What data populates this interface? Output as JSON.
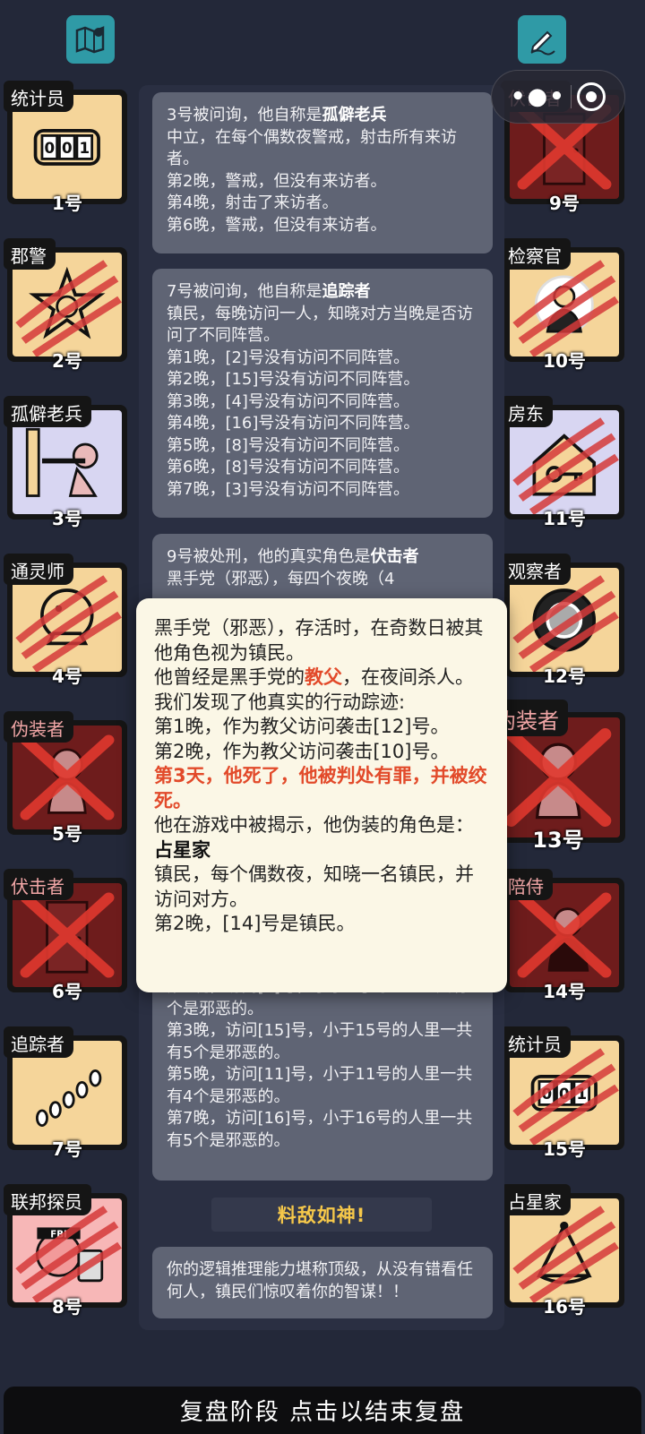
{
  "header": {
    "left_icon": "map-icon",
    "right_icon": "edit-icon",
    "capsule": {
      "menu_icon": "more-dots-icon",
      "close_icon": "target-close-icon"
    }
  },
  "colors": {
    "accent_teal": "#2f9aa6",
    "bg": "#232839",
    "dead_card": "#6e1c1c",
    "alive_card": "#f5d59a",
    "highlight_red": "#e24a2a",
    "banner_gold": "#f6c84a"
  },
  "left_cards": [
    {
      "role": "统计员",
      "num": "1号",
      "icon": "counter-icon",
      "dead": false
    },
    {
      "role": "郡警",
      "num": "2号",
      "icon": "sheriff-badge-icon",
      "dead": false,
      "slashed": true
    },
    {
      "role": "孤僻老兵",
      "num": "3号",
      "icon": "veteran-gun-icon",
      "dead": false
    },
    {
      "role": "通灵师",
      "num": "4号",
      "icon": "crystal-ball-icon",
      "dead": false,
      "slashed": true
    },
    {
      "role": "伪装者",
      "num": "5号",
      "icon": "disguiser-icon",
      "dead": true
    },
    {
      "role": "伏击者",
      "num": "6号",
      "icon": "door-icon",
      "dead": true
    },
    {
      "role": "追踪者",
      "num": "7号",
      "icon": "footprints-icon",
      "dead": false
    },
    {
      "role": "联邦探员",
      "num": "8号",
      "icon": "fbi-agent-icon",
      "dead": false,
      "slashed": true
    }
  ],
  "right_cards": [
    {
      "role": "伏击者",
      "num": "9号",
      "icon": "door-icon",
      "dead": true
    },
    {
      "role": "检察官",
      "num": "10号",
      "icon": "prosecutor-icon",
      "dead": false,
      "slashed": true
    },
    {
      "role": "房东",
      "num": "11号",
      "icon": "house-key-icon",
      "dead": false,
      "slashed": true
    },
    {
      "role": "观察者",
      "num": "12号",
      "icon": "eye-lens-icon",
      "dead": false,
      "slashed": true
    },
    {
      "role": "伪装者",
      "num": "13号",
      "icon": "disguiser-icon",
      "dead": true
    },
    {
      "role": "陪侍",
      "num": "14号",
      "icon": "escort-icon",
      "dead": true
    },
    {
      "role": "统计员",
      "num": "15号",
      "icon": "counter-icon",
      "dead": false,
      "slashed": true
    },
    {
      "role": "占星家",
      "num": "16号",
      "icon": "sextant-icon",
      "dead": false,
      "slashed": true
    }
  ],
  "log": {
    "box1": {
      "head": "3号被问询，他自称是",
      "role": "孤僻老兵",
      "lines": [
        "中立，在每个偶数夜警戒，射击所有来访者。",
        "第2晚，警戒，但没有来访者。",
        "第4晚，射击了来访者。",
        "第6晚，警戒，但没有来访者。"
      ]
    },
    "box2": {
      "head": "7号被问询，他自称是",
      "role": "追踪者",
      "lines": [
        "镇民，每晚访问一人，知晓对方当晚是否访问了不同阵营。",
        "第1晚，[2]号没有访问不同阵营。",
        "第2晚，[15]号没有访问不同阵营。",
        "第3晚，[4]号没有访问不同阵营。",
        "第4晚，[16]号没有访问不同阵营。",
        "第5晚，[8]号没有访问不同阵营。",
        "第6晚，[8]号没有访问不同阵营。",
        "第7晚，[3]号没有访问不同阵营。"
      ]
    },
    "box3": {
      "head": "9号被处刑，他的真实角色是",
      "role": "伏击者",
      "partial": "黑手党（邪恶），每四个夜晚（4",
      "lines": [
        "第1晚，访问[2]号，小于2号的人里一共有1个是邪恶的。",
        "第3晚，访问[15]号，小于15号的人里一共有5个是邪恶的。",
        "第5晚，访问[11]号，小于11号的人里一共有4个是邪恶的。",
        "第7晚，访问[16]号，小于16号的人里一共有5个是邪恶的。"
      ]
    },
    "banner": "料敌如神!",
    "box4": "你的逻辑推理能力堪称顶级，从没有错看任何人，镇民们惊叹着你的智谋！！"
  },
  "popup": {
    "line1": "黑手党（邪恶），存活时，在奇数日被其他角色视为镇民。",
    "line2_pre": "他曾经是黑手党的",
    "line2_role": "教父",
    "line2_post": "，在夜间杀人。",
    "line3": "我们发现了他真实的行动踪迹:",
    "line4": "第1晚，作为教父访问袭击[12]号。",
    "line5": "第2晚，作为教父访问袭击[10]号。",
    "line6_red": "第3天，他死了，他被判处有罪，并被绞死。",
    "line7_pre": "他在游戏中被揭示，他伪装的角色是：",
    "line7_role": "占星家",
    "line8": "镇民，每个偶数夜，知晓一名镇民，并访问对方。",
    "line9": "第2晚，[14]号是镇民。"
  },
  "footer": {
    "label": "复盘阶段 点击以结束复盘"
  }
}
